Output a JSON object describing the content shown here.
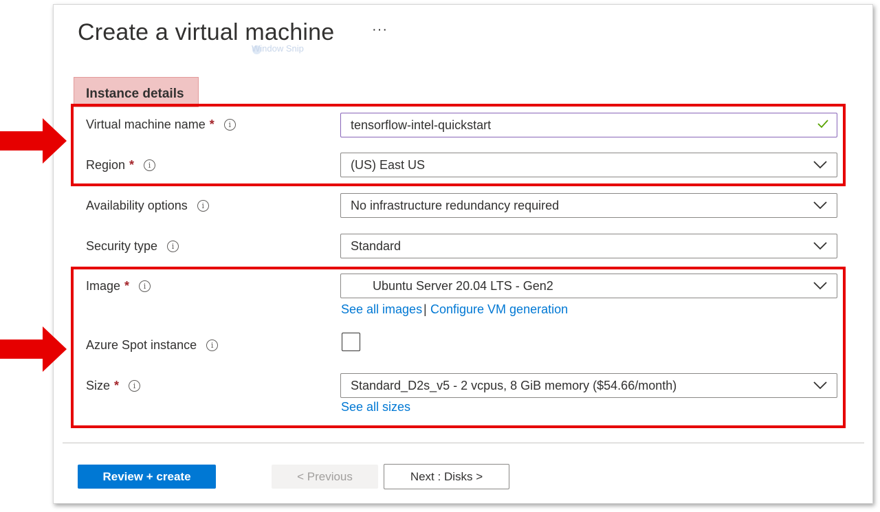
{
  "page": {
    "title": "Create a virtual machine",
    "more_label": "···",
    "ghost_text": "Window Snip"
  },
  "section": {
    "title": "Instance details"
  },
  "fields": {
    "vm_name": {
      "label": "Virtual machine name",
      "required": "*",
      "value": "tensorflow-intel-quickstart",
      "valid": true
    },
    "region": {
      "label": "Region",
      "required": "*",
      "value": "(US) East US"
    },
    "availability": {
      "label": "Availability options",
      "value": "No infrastructure redundancy required"
    },
    "security": {
      "label": "Security type",
      "value": "Standard"
    },
    "image": {
      "label": "Image",
      "required": "*",
      "value": "Ubuntu Server 20.04 LTS - Gen2",
      "link_all": "See all images",
      "separator": "|",
      "link_config": "Configure VM generation"
    },
    "spot": {
      "label": "Azure Spot instance",
      "checked": false
    },
    "size": {
      "label": "Size",
      "required": "*",
      "value": "Standard_D2s_v5 - 2 vcpus, 8 GiB memory ($54.66/month)",
      "link_all": "See all sizes"
    }
  },
  "footer": {
    "review_label": "Review + create",
    "previous_label": "< Previous",
    "next_label": "Next : Disks >"
  },
  "icons": {
    "info": "info-icon",
    "chevron": "chevron-down-icon",
    "check": "checkmark-icon",
    "arrow": "red-arrow-icon"
  },
  "colors": {
    "primary": "#0078d4",
    "link": "#0078d4",
    "required": "#a4262c",
    "annotation_red": "#e60000",
    "section_highlight": "#f0c4c4",
    "valid_check": "#57a300",
    "focus_border": "#8764b8"
  }
}
